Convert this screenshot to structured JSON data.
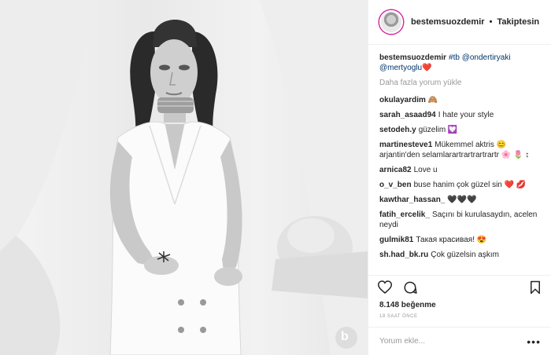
{
  "post": {
    "photo_alt": "black and white portrait of a woman in a white sleeveless blazer dress",
    "watermark": "b"
  },
  "header": {
    "username": "bestemsuozdemir",
    "separator": "•",
    "follow_status": "Takiptesin"
  },
  "caption": {
    "username": "bestemsuozdemir",
    "text": "#tb @ondertiryaki @mertyoglu",
    "emoji": "❤️"
  },
  "load_more": "Daha fazla yorum yükle",
  "comments": [
    {
      "user": "okulayardim",
      "text": "🙈"
    },
    {
      "user": "sarah_asaad94",
      "text": "I hate your style"
    },
    {
      "user": "setodeh.y",
      "text": "güzelim 💟"
    },
    {
      "user": "martinesteve1",
      "text": "Mükemmel aktris 😊 arjantin'den selamlarartrartrartrartr 🌸 🌷 ↕"
    },
    {
      "user": "arnica82",
      "text": "Love u"
    },
    {
      "user": "o_v_ben",
      "text": "buse hanim çok güzel sin ❤️ 💋"
    },
    {
      "user": "kawthar_hassan_",
      "text": "🖤🖤🖤"
    },
    {
      "user": "fatih_ercelik_",
      "text": "Saçını bi kurulasaydın, acelen neydi"
    },
    {
      "user": "gulmik81",
      "text": "Такая красивая! 😍"
    },
    {
      "user": "sh.had_bk.ru",
      "text": "Çok güzelsin aşkım"
    }
  ],
  "icons": {
    "like": "heart-icon",
    "comment": "comment-icon",
    "save": "bookmark-icon"
  },
  "likes": "8.148 beğenme",
  "time_ago": "18 SAAT ÖNCE",
  "add_comment": {
    "placeholder": "Yorum ekle...",
    "more": "•••"
  }
}
